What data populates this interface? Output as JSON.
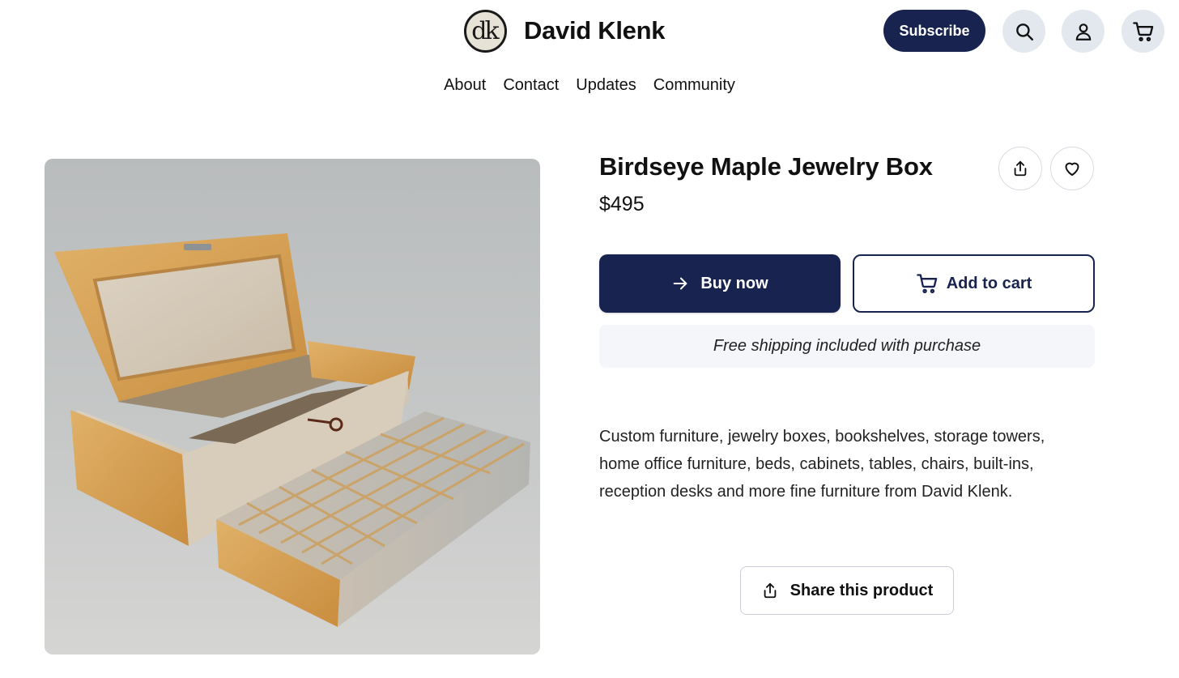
{
  "header": {
    "logo_text": "dk",
    "brand_name": "David Klenk",
    "subscribe_label": "Subscribe",
    "search_icon": "search-icon",
    "account_icon": "user-icon",
    "cart_icon": "cart-icon"
  },
  "nav": {
    "items": [
      {
        "label": "About"
      },
      {
        "label": "Contact"
      },
      {
        "label": "Updates"
      },
      {
        "label": "Community"
      }
    ]
  },
  "product": {
    "image_icon": "jewelry-box-photo",
    "title": "Birdseye Maple Jewelry Box",
    "price": "$495",
    "share_icon": "share-icon",
    "favorite_icon": "heart-icon",
    "buy_label": "Buy now",
    "buy_icon": "arrow-right-icon",
    "add_to_cart_label": "Add to cart",
    "add_to_cart_icon": "cart-icon",
    "shipping_note": "Free shipping included with purchase",
    "description": "Custom furniture, jewelry boxes, bookshelves, storage towers, home office furniture, beds, cabinets, tables, chairs, built-ins, reception desks and more fine furniture from David Klenk.",
    "share_product_label": "Share this product"
  },
  "colors": {
    "primary": "#18244f",
    "icon_button_bg": "#e3e8ef",
    "shipping_bg": "#f4f6f9"
  }
}
